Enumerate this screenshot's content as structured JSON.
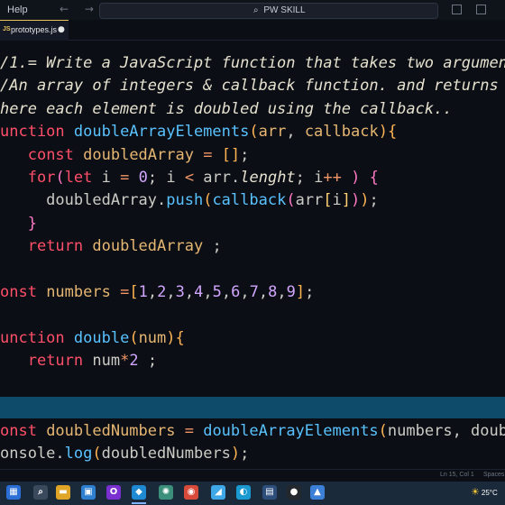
{
  "titlebar": {
    "menu_help": "Help",
    "back_arrow": "←",
    "forward_arrow": "→",
    "search_icon": "⌕",
    "command_center": "PW SKILL"
  },
  "tabs": [
    {
      "icon": "JS",
      "label": "prototypes.js",
      "modified_dot": "●"
    }
  ],
  "code": {
    "lines": [
      [
        {
          "c": "cmt",
          "t": "/1.= Write a JavaScript function that takes two argumen"
        }
      ],
      [
        {
          "c": "cmt",
          "t": "/An array of integers & callback function. and returns"
        }
      ],
      [
        {
          "c": "cmt",
          "t": "here each element is doubled using the callback.."
        }
      ],
      [
        {
          "c": "kw",
          "t": "unction "
        },
        {
          "c": "fn",
          "t": "doubleArrayElements"
        },
        {
          "c": "par",
          "t": "("
        },
        {
          "c": "pn",
          "t": "arr"
        },
        {
          "c": "tx",
          "t": ", "
        },
        {
          "c": "pn",
          "t": "callback"
        },
        {
          "c": "par",
          "t": "){"
        }
      ],
      [
        {
          "c": "tx",
          "t": "   "
        },
        {
          "c": "kw",
          "t": "const "
        },
        {
          "c": "vr",
          "t": "doubledArray"
        },
        {
          "c": "op",
          "t": " = "
        },
        {
          "c": "par",
          "t": "[]"
        },
        {
          "c": "tx",
          "t": ";"
        }
      ],
      [
        {
          "c": "tx",
          "t": "   "
        },
        {
          "c": "kw",
          "t": "for"
        },
        {
          "c": "pink",
          "t": "("
        },
        {
          "c": "kw",
          "t": "let "
        },
        {
          "c": "tx",
          "t": "i "
        },
        {
          "c": "op",
          "t": "= "
        },
        {
          "c": "num",
          "t": "0"
        },
        {
          "c": "tx",
          "t": "; i "
        },
        {
          "c": "op",
          "t": "< "
        },
        {
          "c": "tx",
          "t": "arr."
        },
        {
          "c": "cmt",
          "t": "lenght"
        },
        {
          "c": "tx",
          "t": "; i"
        },
        {
          "c": "op",
          "t": "++ "
        },
        {
          "c": "pink",
          "t": ") {"
        }
      ],
      [
        {
          "c": "tx",
          "t": "     doubledArray."
        },
        {
          "c": "fn",
          "t": "push"
        },
        {
          "c": "par",
          "t": "("
        },
        {
          "c": "fn",
          "t": "callback"
        },
        {
          "c": "pink",
          "t": "("
        },
        {
          "c": "tx",
          "t": "arr"
        },
        {
          "c": "yel",
          "t": "["
        },
        {
          "c": "tx",
          "t": "i"
        },
        {
          "c": "yel",
          "t": "]"
        },
        {
          "c": "pink",
          "t": ")"
        },
        {
          "c": "par",
          "t": ")"
        },
        {
          "c": "tx",
          "t": ";"
        }
      ],
      [
        {
          "c": "tx",
          "t": "   "
        },
        {
          "c": "pink",
          "t": "}"
        }
      ],
      [
        {
          "c": "tx",
          "t": "   "
        },
        {
          "c": "kw",
          "t": "return "
        },
        {
          "c": "vr",
          "t": "doubledArray"
        },
        {
          "c": "tx",
          "t": " ;"
        }
      ],
      [
        {
          "c": "tx",
          "t": ""
        }
      ],
      [
        {
          "c": "kw",
          "t": "onst "
        },
        {
          "c": "vr",
          "t": "numbers"
        },
        {
          "c": "op",
          "t": " ="
        },
        {
          "c": "par",
          "t": "["
        },
        {
          "c": "num",
          "t": "1"
        },
        {
          "c": "tx",
          "t": ","
        },
        {
          "c": "num",
          "t": "2"
        },
        {
          "c": "tx",
          "t": ","
        },
        {
          "c": "num",
          "t": "3"
        },
        {
          "c": "tx",
          "t": ","
        },
        {
          "c": "num",
          "t": "4"
        },
        {
          "c": "tx",
          "t": ","
        },
        {
          "c": "num",
          "t": "5"
        },
        {
          "c": "tx",
          "t": ","
        },
        {
          "c": "num",
          "t": "6"
        },
        {
          "c": "tx",
          "t": ","
        },
        {
          "c": "num",
          "t": "7"
        },
        {
          "c": "tx",
          "t": ","
        },
        {
          "c": "num",
          "t": "8"
        },
        {
          "c": "tx",
          "t": ","
        },
        {
          "c": "num",
          "t": "9"
        },
        {
          "c": "par",
          "t": "]"
        },
        {
          "c": "tx",
          "t": ";"
        }
      ],
      [
        {
          "c": "tx",
          "t": ""
        }
      ],
      [
        {
          "c": "kw",
          "t": "unction "
        },
        {
          "c": "fn",
          "t": "double"
        },
        {
          "c": "par",
          "t": "("
        },
        {
          "c": "pn",
          "t": "num"
        },
        {
          "c": "par",
          "t": "){"
        }
      ],
      [
        {
          "c": "tx",
          "t": "   "
        },
        {
          "c": "kw",
          "t": "return "
        },
        {
          "c": "tx",
          "t": "num"
        },
        {
          "c": "op",
          "t": "*"
        },
        {
          "c": "num",
          "t": "2"
        },
        {
          "c": "tx",
          "t": " ;"
        }
      ]
    ],
    "lines_bottom": [
      [
        {
          "c": "kw",
          "t": "onst "
        },
        {
          "c": "vr",
          "t": "doubledNumbers"
        },
        {
          "c": "op",
          "t": " = "
        },
        {
          "c": "fn",
          "t": "doubleArrayElements"
        },
        {
          "c": "par",
          "t": "("
        },
        {
          "c": "tx",
          "t": "numbers, doub"
        }
      ],
      [
        {
          "c": "tx",
          "t": "onsole."
        },
        {
          "c": "fn",
          "t": "log"
        },
        {
          "c": "par",
          "t": "("
        },
        {
          "c": "tx",
          "t": "doubledNumbers"
        },
        {
          "c": "par",
          "t": ")"
        },
        {
          "c": "tx",
          "t": ";"
        }
      ]
    ]
  },
  "statusbar": {
    "position": "Ln 15, Col 1",
    "spaces": "Spaces"
  },
  "taskbar": {
    "apps": [
      {
        "name": "windows-start-icon",
        "glyph": "▦",
        "color": "#2b6fd6"
      },
      {
        "name": "search-icon",
        "glyph": "⌕",
        "color": "#3a4a5c"
      },
      {
        "name": "file-explorer-icon",
        "glyph": "▬",
        "color": "#e0a526"
      },
      {
        "name": "store-icon",
        "glyph": "▣",
        "color": "#2f7fd1"
      },
      {
        "name": "opera-icon",
        "glyph": "O",
        "color": "#7a2fd1"
      },
      {
        "name": "vscode-icon",
        "glyph": "◆",
        "color": "#1f8ad2"
      },
      {
        "name": "chatgpt-icon",
        "glyph": "✺",
        "color": "#3c8f7a"
      },
      {
        "name": "chrome-icon",
        "glyph": "◉",
        "color": "#d84a3a"
      },
      {
        "name": "flutter-icon",
        "glyph": "◢",
        "color": "#3fa9e8"
      },
      {
        "name": "edge-icon",
        "glyph": "◐",
        "color": "#1a9ad0"
      },
      {
        "name": "terminal-icon",
        "glyph": "▤",
        "color": "#2d4d7a"
      },
      {
        "name": "github-icon",
        "glyph": "●",
        "color": "#23272e"
      },
      {
        "name": "photos-icon",
        "glyph": "▲",
        "color": "#3b7fd6"
      }
    ],
    "temperature": "25°C",
    "weather_icon": "☀"
  }
}
